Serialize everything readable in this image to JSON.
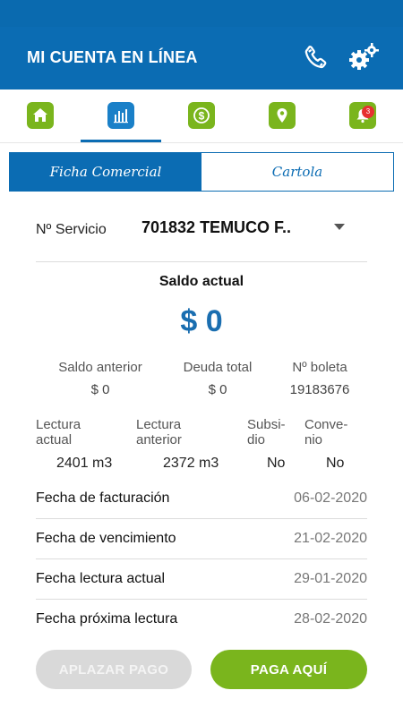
{
  "appbar": {
    "title": "MI CUENTA EN LÍNEA",
    "phone_icon": "phone-icon",
    "settings_icon": "gears-icon"
  },
  "nav": {
    "items": [
      {
        "name": "home",
        "icon": "home-icon"
      },
      {
        "name": "chart",
        "icon": "bar-chart-icon"
      },
      {
        "name": "payment",
        "icon": "dollar-icon"
      },
      {
        "name": "location",
        "icon": "map-pin-icon"
      },
      {
        "name": "notifications",
        "icon": "bell-icon"
      }
    ],
    "badge": "3"
  },
  "tabs": {
    "ficha": "Ficha Comercial",
    "cartola": "Cartola"
  },
  "service": {
    "label": "Nº Servicio",
    "value": "701832 TEMUCO F.."
  },
  "saldo": {
    "label": "Saldo actual",
    "value": "$ 0"
  },
  "summary": {
    "saldo_anterior": {
      "label": "Saldo anterior",
      "value": "$ 0"
    },
    "deuda_total": {
      "label": "Deuda total",
      "value": "$ 0"
    },
    "boleta": {
      "label": "Nº boleta",
      "value": "19183676"
    }
  },
  "readings": {
    "lectura_actual": {
      "label_1": "Lectura",
      "label_2": "actual",
      "value": "2401 m3"
    },
    "lectura_anterior": {
      "label_1": "Lectura",
      "label_2": "anterior",
      "value": "2372 m3"
    },
    "subsidio": {
      "label_1": "Subsi-",
      "label_2": "dio",
      "value": "No"
    },
    "convenio": {
      "label_1": "Conve-",
      "label_2": "nio",
      "value": "No"
    }
  },
  "dates": [
    {
      "label": "Fecha de facturación",
      "value": "06-02-2020"
    },
    {
      "label": "Fecha de vencimiento",
      "value": "21-02-2020"
    },
    {
      "label": "Fecha lectura actual",
      "value": "29-01-2020"
    },
    {
      "label": "Fecha próxima lectura",
      "value": "28-02-2020"
    }
  ],
  "buttons": {
    "aplazar": "APLAZAR PAGO",
    "pagar": "PAGA AQUÍ"
  },
  "colors": {
    "primary_blue": "#0b6cb3",
    "accent_green": "#7ab51d",
    "amount_blue": "#1a6eb0"
  }
}
